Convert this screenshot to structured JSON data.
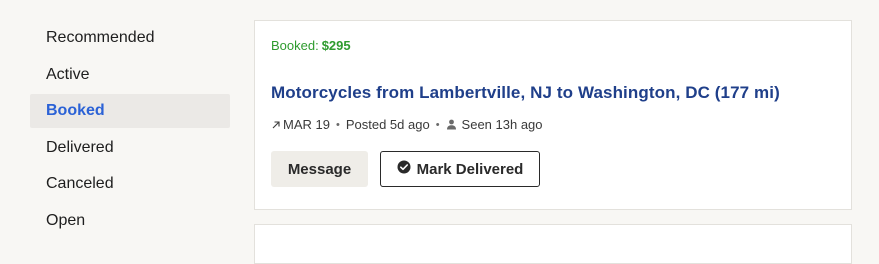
{
  "sidebar": {
    "items": [
      {
        "label": "Recommended"
      },
      {
        "label": "Active"
      },
      {
        "label": "Booked"
      },
      {
        "label": "Delivered"
      },
      {
        "label": "Canceled"
      },
      {
        "label": "Open"
      }
    ],
    "selected": "Booked"
  },
  "load": {
    "booked_label": "Booked:",
    "price": "$295",
    "title": "Motorcycles from Lambertville, NJ to Washington, DC (177 mi)",
    "date": "MAR 19",
    "posted": "Posted 5d ago",
    "seen": "Seen 13h ago",
    "separator": "•",
    "icons": {
      "date": "arrow-up-right-icon",
      "seen": "person-icon"
    }
  },
  "actions": {
    "message_label": "Message",
    "deliver_label": "Mark Delivered",
    "deliver_icon": "check-circle-icon"
  },
  "colors": {
    "accent": "#2b62d6",
    "booked_green": "#2e9b2e",
    "title_blue": "#1f3f8a",
    "selected_bg": "#ebe9e6",
    "page_bg": "#f8f7f4"
  }
}
